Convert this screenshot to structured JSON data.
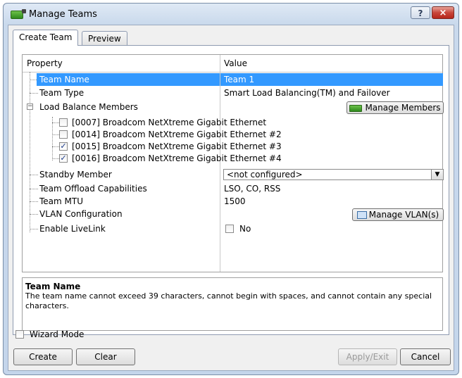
{
  "window": {
    "title": "Manage Teams",
    "help_label": "?",
    "close_label": "×"
  },
  "tabs": [
    {
      "label": "Create Team"
    },
    {
      "label": "Preview"
    }
  ],
  "grid": {
    "headers": {
      "property": "Property",
      "value": "Value"
    },
    "rows": {
      "team_name": {
        "name": "Team Name",
        "value": "Team 1"
      },
      "team_type": {
        "name": "Team Type",
        "value": "Smart Load Balancing(TM) and Failover"
      },
      "lbm": {
        "name": "Load Balance Members",
        "expander": "−",
        "button": "Manage Members"
      },
      "members": [
        {
          "name": "[0007] Broadcom NetXtreme Gigabit Ethernet",
          "checked": false
        },
        {
          "name": "[0014] Broadcom NetXtreme Gigabit Ethernet #2",
          "checked": false
        },
        {
          "name": "[0015] Broadcom NetXtreme Gigabit Ethernet #3",
          "checked": true
        },
        {
          "name": "[0016] Broadcom NetXtreme Gigabit Ethernet #4",
          "checked": true
        }
      ],
      "standby": {
        "name": "Standby Member",
        "value": "<not configured>",
        "arrow": "▼"
      },
      "offload": {
        "name": "Team Offload Capabilities",
        "value": "LSO, CO, RSS"
      },
      "mtu": {
        "name": "Team MTU",
        "value": "1500"
      },
      "vlan": {
        "name": "VLAN Configuration",
        "button": "Manage VLAN(s)"
      },
      "livelink": {
        "name": "Enable LiveLink",
        "value": "No",
        "checked": false
      }
    }
  },
  "description": {
    "title": "Team Name",
    "text": "The team name cannot exceed 39 characters, cannot begin with spaces, and cannot contain any special characters."
  },
  "wizard_mode": {
    "label": "Wizard Mode",
    "checked": false
  },
  "buttons": {
    "create": "Create",
    "clear": "Clear",
    "apply_exit": "Apply/Exit",
    "cancel": "Cancel"
  },
  "check_mark": "✓",
  "colors": {
    "selection": "#3399ff",
    "title_gradient": "#c9d9ec"
  }
}
